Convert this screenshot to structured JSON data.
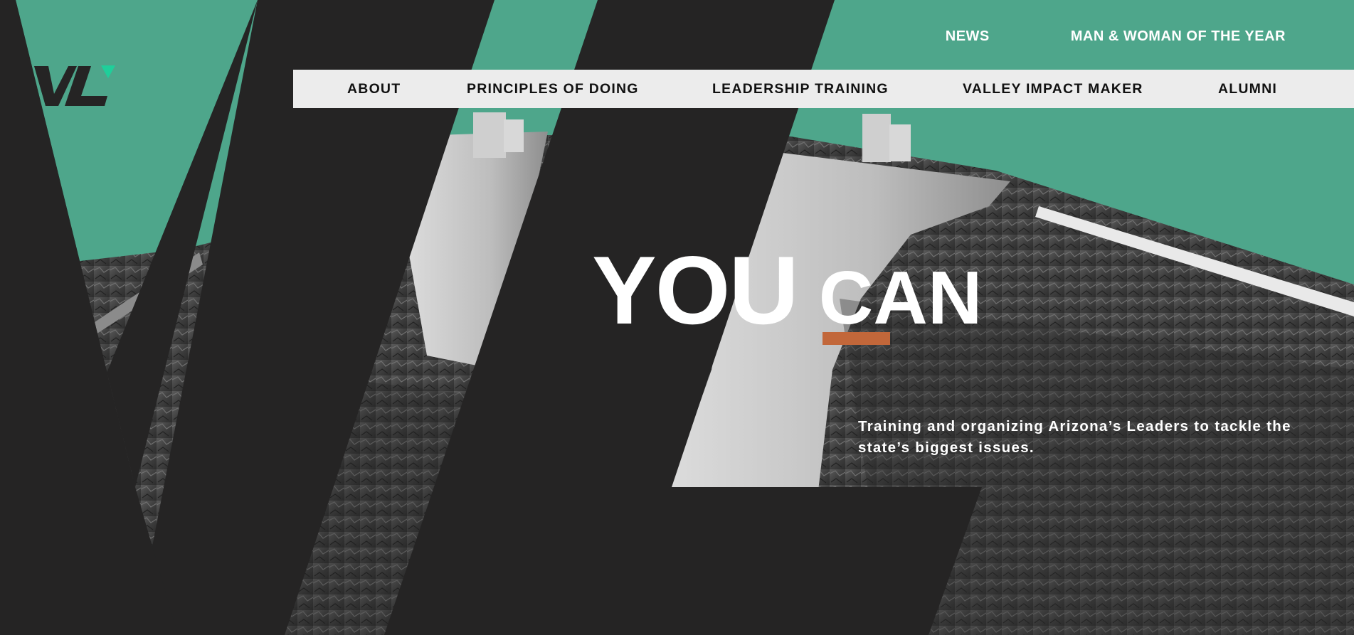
{
  "colors": {
    "brand_green": "#4ea68b",
    "dark": "#252424",
    "nav_bar_bg": "#ececec",
    "accent": "#c2673a",
    "logo_mark": "#1fcf9a"
  },
  "logo": {
    "text": "VL"
  },
  "utility_nav": [
    {
      "label": "NEWS"
    },
    {
      "label": "MAN & WOMAN OF THE YEAR"
    }
  ],
  "main_nav": [
    {
      "label": "ABOUT"
    },
    {
      "label": "PRINCIPLES OF DOING"
    },
    {
      "label": "LEADERSHIP TRAINING"
    },
    {
      "label": "VALLEY IMPACT MAKER"
    },
    {
      "label": "ALUMNI"
    }
  ],
  "hero": {
    "headline_word_1": "YOU",
    "headline_word_2": "CAN",
    "tagline": "Training and organizing Arizona’s Leaders to tackle the state’s biggest issues.",
    "background_image": "grayscale photo of a concrete dam wall and rocky canyon"
  }
}
